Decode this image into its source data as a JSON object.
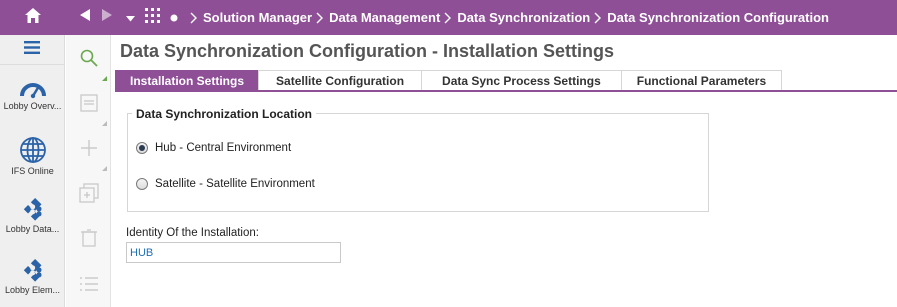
{
  "topbar": {
    "breadcrumbs": [
      "Solution Manager",
      "Data Management",
      "Data Synchronization",
      "Data Synchronization Configuration"
    ],
    "color": "#8e4f96"
  },
  "sidebar": {
    "items": [
      {
        "label": "Lobby Overv...",
        "icon": "gauge-icon"
      },
      {
        "label": "IFS Online",
        "icon": "globe-icon"
      },
      {
        "label": "Lobby Data...",
        "icon": "puzzle-icon"
      },
      {
        "label": "Lobby Elem...",
        "icon": "puzzle-icon"
      }
    ]
  },
  "commands": [
    "search-icon",
    "edit-icon",
    "add-icon",
    "duplicate-icon",
    "delete-icon",
    "list-icon"
  ],
  "page": {
    "title": "Data Synchronization Configuration - Installation Settings"
  },
  "tabs": [
    {
      "label": "Installation Settings",
      "active": true
    },
    {
      "label": "Satellite Configuration",
      "active": false
    },
    {
      "label": "Data Sync Process Settings",
      "active": false
    },
    {
      "label": "Functional Parameters",
      "active": false
    }
  ],
  "location_group": {
    "title": "Data Synchronization Location",
    "options": [
      {
        "label": "Hub - Central Environment",
        "selected": true
      },
      {
        "label": "Satellite - Satellite Environment",
        "selected": false
      }
    ]
  },
  "identity_field": {
    "label": "Identity Of the Installation:",
    "value": "HUB"
  }
}
